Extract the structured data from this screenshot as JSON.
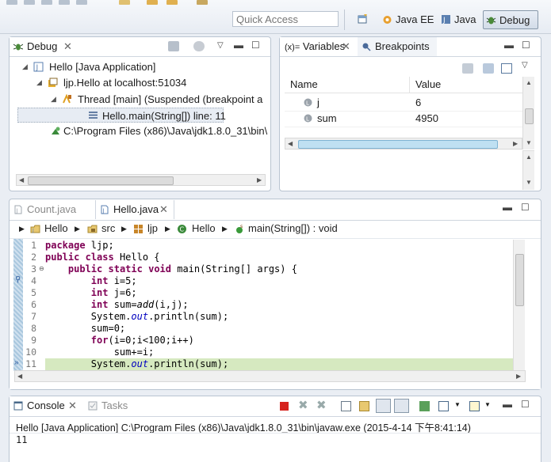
{
  "toolbar": {
    "quick_access_placeholder": "Quick Access",
    "perspectives": [
      {
        "label": "Java EE",
        "icon": "java-ee-perspective-icon"
      },
      {
        "label": "Java",
        "icon": "java-perspective-icon"
      },
      {
        "label": "Debug",
        "icon": "debug-perspective-icon",
        "active": true
      }
    ]
  },
  "debug_view": {
    "tab_label": "Debug",
    "tree": [
      {
        "label": "Hello [Java Application]"
      },
      {
        "label": "ljp.Hello at localhost:51034"
      },
      {
        "label": "Thread [main] (Suspended (breakpoint a"
      },
      {
        "label": "Hello.main(String[]) line: 11"
      },
      {
        "label": "C:\\Program Files (x86)\\Java\\jdk1.8.0_31\\bin\\"
      }
    ]
  },
  "variables_view": {
    "tabs": [
      {
        "label": "Variables",
        "prefix": "(x)="
      },
      {
        "label": "Breakpoints"
      }
    ],
    "columns": [
      "Name",
      "Value"
    ],
    "rows": [
      {
        "name": "j",
        "value": "6"
      },
      {
        "name": "sum",
        "value": "4950"
      }
    ]
  },
  "editor": {
    "tabs": [
      {
        "label": "Count.java",
        "active": false
      },
      {
        "label": "Hello.java",
        "active": true
      }
    ],
    "breadcrumb": [
      {
        "label": "Hello",
        "icon": "project-icon"
      },
      {
        "label": "src",
        "icon": "source-folder-icon"
      },
      {
        "label": "ljp",
        "icon": "package-icon"
      },
      {
        "label": "Hello",
        "icon": "class-icon"
      },
      {
        "label": "main(String[]) : void",
        "icon": "method-icon"
      }
    ],
    "line_numbers": [
      "1",
      "2",
      "3",
      "4",
      "5",
      "6",
      "7",
      "8",
      "9",
      "10",
      "11"
    ],
    "current_line": "11",
    "breakpoint_line": "4"
  },
  "console_view": {
    "tabs": [
      {
        "label": "Console",
        "active": true
      },
      {
        "label": "Tasks",
        "active": false
      }
    ],
    "launch_info": "Hello [Java Application] C:\\Program Files (x86)\\Java\\jdk1.8.0_31\\bin\\javaw.exe (2015-4-14 下午8:41:14)",
    "output": "11"
  },
  "colors": {
    "keyword": "#7f0055",
    "field": "#0000c0",
    "current_line_highlight": "#d6e9c0",
    "panel_border": "#b9c4d1"
  }
}
